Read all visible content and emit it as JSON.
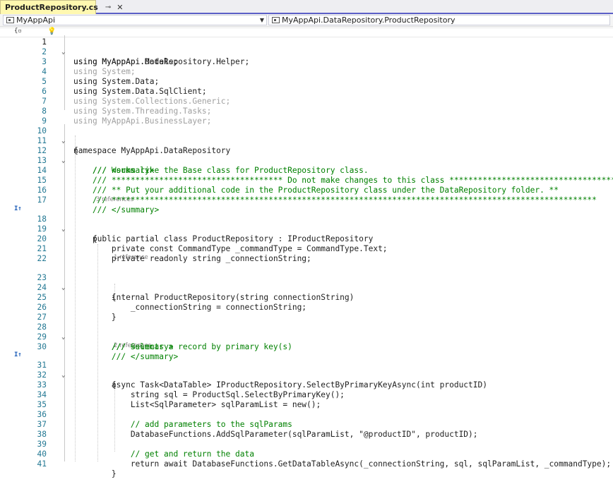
{
  "tab": {
    "title": "ProductRepository.cs",
    "pin_icon": "pin-icon",
    "close_icon": "close-icon"
  },
  "navbar": {
    "project": "MyAppApi",
    "type": "MyAppApi.DataRepository.ProductRepository"
  },
  "codelens": {
    "l17": "3 references",
    "l22": "1 reference",
    "l30": "2 references"
  },
  "lines": [
    {
      "n": "1",
      "code": "using MyAppApi.DataRepository.Helper;"
    },
    {
      "n": "2",
      "code": "using MyAppApi.Models;"
    },
    {
      "n": "3",
      "code": "using System;"
    },
    {
      "n": "4",
      "code": "using System.Data;"
    },
    {
      "n": "5",
      "code": "using System.Data.SqlClient;"
    },
    {
      "n": "6",
      "code": "using System.Collections.Generic;"
    },
    {
      "n": "7",
      "code": "using System.Threading.Tasks;"
    },
    {
      "n": "8",
      "code": "using MyAppApi.BusinessLayer;"
    },
    {
      "n": "9",
      "code": ""
    },
    {
      "n": "10",
      "code": "namespace MyAppApi.DataRepository"
    },
    {
      "n": "11",
      "code": "{"
    },
    {
      "n": "12",
      "code": "    /// <summary>"
    },
    {
      "n": "13",
      "code": "    /// Works like the Base class for ProductRepository class."
    },
    {
      "n": "14",
      "code": "    /// ************************************ Do not make changes to this class ************************************"
    },
    {
      "n": "15",
      "code": "    /// ** Put your additional code in the ProductRepository class under the DataRepository folder. **"
    },
    {
      "n": "16",
      "code": "    /// ******************************************************************************************************"
    },
    {
      "n": "17",
      "code": "    /// </summary>"
    },
    {
      "n": "18",
      "code": "    public partial class ProductRepository : IProductRepository"
    },
    {
      "n": "19",
      "code": "    {"
    },
    {
      "n": "20",
      "code": "        private const CommandType _commandType = CommandType.Text;"
    },
    {
      "n": "21",
      "code": "        private readonly string _connectionString;"
    },
    {
      "n": "22",
      "code": ""
    },
    {
      "n": "23",
      "code": "        internal ProductRepository(string connectionString)"
    },
    {
      "n": "24",
      "code": "        {"
    },
    {
      "n": "25",
      "code": "            _connectionString = connectionString;"
    },
    {
      "n": "26",
      "code": "        }"
    },
    {
      "n": "27",
      "code": ""
    },
    {
      "n": "28",
      "code": "        /// <summary>"
    },
    {
      "n": "29",
      "code": "        /// Selects a record by primary key(s)"
    },
    {
      "n": "30",
      "code": "        /// </summary>"
    },
    {
      "n": "31",
      "code": "        async Task<DataTable> IProductRepository.SelectByPrimaryKeyAsync(int productID)"
    },
    {
      "n": "32",
      "code": "        {"
    },
    {
      "n": "33",
      "code": "            string sql = ProductSql.SelectByPrimaryKey();"
    },
    {
      "n": "34",
      "code": "            List<SqlParameter> sqlParamList = new();"
    },
    {
      "n": "35",
      "code": ""
    },
    {
      "n": "36",
      "code": "            // add parameters to the sqlParams"
    },
    {
      "n": "37",
      "code": "            DatabaseFunctions.AddSqlParameter(sqlParamList, \"@productID\", productID);"
    },
    {
      "n": "38",
      "code": ""
    },
    {
      "n": "39",
      "code": "            // get and return the data"
    },
    {
      "n": "40",
      "code": "            return await DatabaseFunctions.GetDataTableAsync(_connectionString, sql, sqlParamList, _commandType);"
    },
    {
      "n": "41",
      "code": "        }"
    }
  ]
}
